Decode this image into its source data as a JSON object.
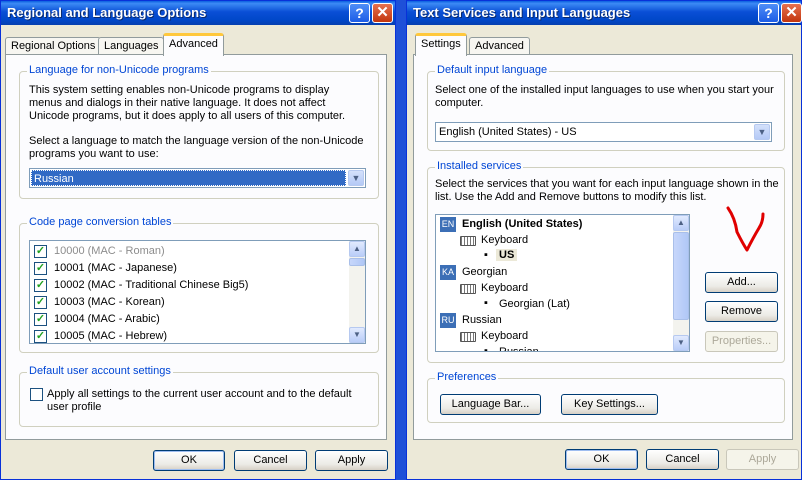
{
  "left": {
    "title": "Regional and Language Options",
    "tabs": [
      "Regional Options",
      "Languages",
      "Advanced"
    ],
    "nonunicode": {
      "label": "Language for non-Unicode programs",
      "desc": "This system setting enables non-Unicode programs to display menus and dialogs in their native language. It does not affect Unicode programs, but it does apply to all users of this computer.",
      "select_text": "Select a language to match the language version of the non-Unicode programs you want to use:",
      "selected": "Russian"
    },
    "codepage": {
      "label": "Code page conversion tables",
      "items": [
        {
          "label": "10000 (MAC - Roman)",
          "checked": true,
          "dim": true
        },
        {
          "label": "10001 (MAC - Japanese)",
          "checked": true,
          "dim": false
        },
        {
          "label": "10002 (MAC - Traditional Chinese Big5)",
          "checked": true,
          "dim": false
        },
        {
          "label": "10003 (MAC - Korean)",
          "checked": true,
          "dim": false
        },
        {
          "label": "10004 (MAC - Arabic)",
          "checked": true,
          "dim": false
        },
        {
          "label": "10005 (MAC - Hebrew)",
          "checked": true,
          "dim": false
        }
      ]
    },
    "defaults": {
      "label": "Default user account settings",
      "apply_line1": "Apply all settings to the current user account and to the default",
      "apply_line2": "user profile",
      "checked": false
    },
    "buttons": {
      "ok": "OK",
      "cancel": "Cancel",
      "apply": "Apply"
    }
  },
  "right": {
    "title": "Text Services and Input Languages",
    "tabs": [
      "Settings",
      "Advanced"
    ],
    "default_lang": {
      "label": "Default input language",
      "desc": "Select one of the installed input languages to use when you start your computer.",
      "selected": "English (United States) - US"
    },
    "services": {
      "label": "Installed services",
      "desc": "Select the services that you want for each input language shown in the list. Use the Add and Remove buttons to modify this list.",
      "tree": [
        {
          "kind": "lang",
          "badge": "EN",
          "label": "English (United States)",
          "bold": true
        },
        {
          "kind": "kb",
          "label": "Keyboard"
        },
        {
          "kind": "layout",
          "label": "US",
          "selected": true
        },
        {
          "kind": "lang",
          "badge": "KA",
          "label": "Georgian",
          "bold": false
        },
        {
          "kind": "kb",
          "label": "Keyboard"
        },
        {
          "kind": "layout",
          "label": "Georgian (Lat)",
          "selected": false
        },
        {
          "kind": "lang",
          "badge": "RU",
          "label": "Russian",
          "bold": false
        },
        {
          "kind": "kb",
          "label": "Keyboard"
        },
        {
          "kind": "layout",
          "label": "Russian",
          "selected": false
        }
      ],
      "buttons": {
        "add": "Add...",
        "remove": "Remove",
        "properties": "Properties..."
      }
    },
    "preferences": {
      "label": "Preferences",
      "language_bar": "Language Bar...",
      "key_settings": "Key Settings..."
    },
    "buttons": {
      "ok": "OK",
      "cancel": "Cancel",
      "apply": "Apply"
    }
  },
  "icons": {
    "help": "help-icon",
    "close": "close-icon",
    "dropdown": "chevron-down-icon",
    "keyboard": "keyboard-icon"
  },
  "colors": {
    "title_blue": "#0047c8",
    "group_label": "#0046d5",
    "selection": "#316ac5",
    "annotation_red": "#e00000"
  }
}
